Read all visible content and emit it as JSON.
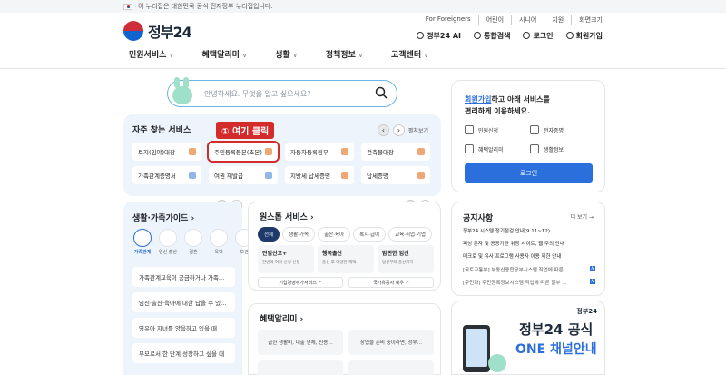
{
  "topstrip": {
    "text": "이 누리집은 대한민국 공식 전자정부 누리집입니다."
  },
  "logo": {
    "text": "정부24"
  },
  "utilnav": [
    "For Foreigners",
    "어린이",
    "시니어",
    "지원",
    "화면크기"
  ],
  "usernav": {
    "ai": "정부24 AI",
    "search": "통합검색",
    "login": "로그인",
    "join": "회원가입"
  },
  "gnb": [
    "민원서비스",
    "혜택알리미",
    "생활",
    "정책정보",
    "고객센터"
  ],
  "search": {
    "placeholder": "안녕하세요. 무엇을 알고 싶으세요?"
  },
  "faq": {
    "title": "자주 찾는 서비스",
    "annotation": "① 여기 클릭",
    "edit": "펼쳐보기",
    "items": [
      "토지(임야)대장",
      "주민등록등본(초본)",
      "자동차등록원부",
      "건축물대장",
      "가족관계증명서",
      "여권 재발급",
      "지방세 납세증명",
      "납세증명"
    ]
  },
  "life": {
    "title": "생활·가족가이드",
    "icons": [
      "가족관계",
      "임신·출산",
      "결혼",
      "육아",
      "보건"
    ],
    "items": [
      "가족관계교육이 궁금하거나 가족…",
      "임신·출산·육아에 대한 답을 수 있…",
      "영유아 자녀를 양육하고 있을 때",
      "부모로서 한 단계 성장하고 싶을 때"
    ]
  },
  "oneclick": {
    "title": "원스톱 서비스",
    "tabs": [
      "전체",
      "생활·가족",
      "출산·육아",
      "복지·급여",
      "교육·취업·기업"
    ],
    "cards": [
      {
        "title": "전입신고+",
        "desc": "한번에 여러 신청 신청"
      },
      {
        "title": "행복출산",
        "desc": "출산 후 다양한 혜택"
      },
      {
        "title": "맘편한 임신",
        "desc": "임신부터 출산까지"
      }
    ],
    "links": [
      "기업경영추가서비스",
      "국가유공자 예우"
    ]
  },
  "benefit": {
    "title": "혜택알리미",
    "cards": [
      "급한 생활비, 대출 연체, 신용…",
      "창업을 준비 중이라면, 정부…",
      "",
      ""
    ]
  },
  "login": {
    "msg_link": "회원가입",
    "msg_rest1": "하고 아래 서비스를",
    "msg_line2": "편리하게 이용하세요.",
    "items": [
      "민원신청",
      "전자증명",
      "혜택알리미",
      "생활정보"
    ],
    "button": "로그인"
  },
  "notice": {
    "title": "공지사항",
    "more": "더 보기",
    "items": [
      "정부24 시스템 정기점검 안내(9.11~12)",
      "피싱 문자 및 공공기관 위장 사이트, 웹 주의 안내",
      "매크로 및 유사 프로그램 사용자 이용 제한 안내",
      "[국토교통부] 부동산종합공부시스템 작업에 따른 …",
      "[주민과] 주민등록정보시스템 작업에 따른 일부 …"
    ]
  },
  "banner": {
    "logo": "정부24",
    "line1": "정부24 공식",
    "line2": "ONE 채널안내"
  },
  "colors": {
    "accent": "#2a6fdb",
    "highlight": "#d42b2b",
    "panel": "#eef4fb"
  }
}
